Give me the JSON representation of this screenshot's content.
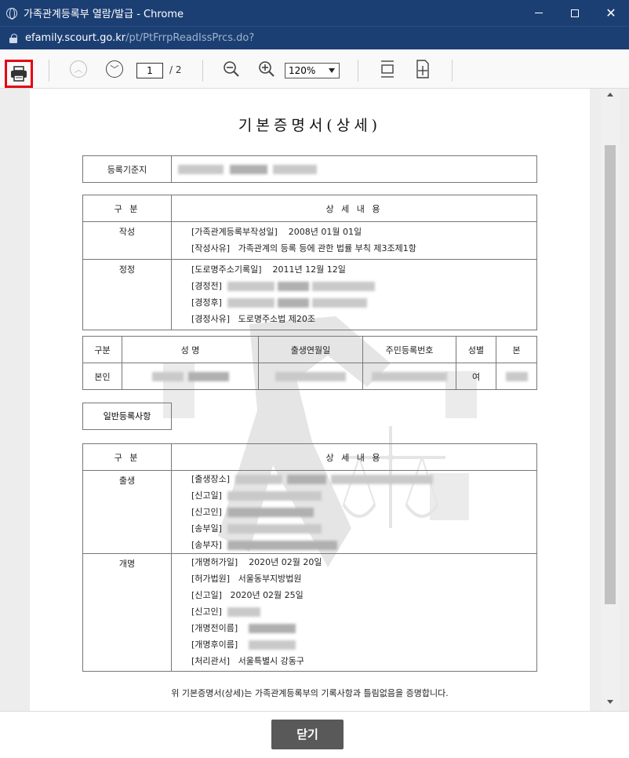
{
  "window": {
    "title": "가족관계등록부 열람/발급 - Chrome"
  },
  "url": {
    "host": "efamily.scourt.go.kr",
    "path": "/pt/PtFrrpReadIssPrcs.do?"
  },
  "toolbar": {
    "page_current": "1",
    "page_total": "/ 2",
    "zoom": "120%"
  },
  "doc": {
    "title": "기본증명서(상세)",
    "basis_label": "등록기준지",
    "detail_header": {
      "col1": "구 분",
      "col2": "상 세 내 용"
    },
    "detail_rows": [
      {
        "category": "작성",
        "lines": [
          {
            "label": "[가족관계등록부작성일]",
            "value": "2008년 01월 01일"
          },
          {
            "label": "[작성사유]",
            "value": "가족관계의 등록 등에 관한 법률 부칙 제3조제1항"
          }
        ]
      },
      {
        "category": "정정",
        "lines": [
          {
            "label": "[도로명주소기록일]",
            "value": "2011년 12월 12일"
          },
          {
            "label": "[경정전]",
            "value": ""
          },
          {
            "label": "[경정후]",
            "value": ""
          },
          {
            "label": "[경정사유]",
            "value": "도로명주소법 제20조"
          }
        ]
      }
    ],
    "person_header": {
      "c1": "구분",
      "c2": "성 명",
      "c3": "출생연월일",
      "c4": "주민등록번호",
      "c5": "성별",
      "c6": "본"
    },
    "person_row": {
      "c1": "본인",
      "c5": "여"
    },
    "general_label": "일반등록사항",
    "general_rows": [
      {
        "category": "출생",
        "lines": [
          {
            "label": "[출생장소]",
            "value": ""
          },
          {
            "label": "[신고일]",
            "value": ""
          },
          {
            "label": "[신고인]",
            "value": ""
          },
          {
            "label": "[송부일]",
            "value": ""
          },
          {
            "label": "[송부자]",
            "value": ""
          }
        ]
      },
      {
        "category": "개명",
        "lines": [
          {
            "label": "[개명허가일]",
            "value": "2020년 02월 20일"
          },
          {
            "label": "[허가법원]",
            "value": "서울동부지방법원"
          },
          {
            "label": "[신고일]",
            "value": "2020년 02월 25일"
          },
          {
            "label": "[신고인]",
            "value": ""
          },
          {
            "label": "[개명전이름]",
            "value": ""
          },
          {
            "label": "[개명후이름]",
            "value": ""
          },
          {
            "label": "[처리관서]",
            "value": "서울특별시 강동구"
          }
        ]
      }
    ],
    "footer_note": "위 기본증명서(상세)는 가족관계등록부의 기록사항과 틀림없음을 증명합니다."
  },
  "bottom": {
    "close_label": "닫기"
  },
  "icons": [
    "globe-icon",
    "lock-icon",
    "print-icon",
    "page-up-icon",
    "page-down-icon",
    "zoom-out-icon",
    "zoom-in-icon",
    "fit-page-icon",
    "fit-width-icon",
    "minimize-icon",
    "maximize-icon",
    "close-icon"
  ],
  "colors": {
    "titlebar": "#1c3f73",
    "highlight": "#e60012",
    "close_button": "#595959"
  }
}
